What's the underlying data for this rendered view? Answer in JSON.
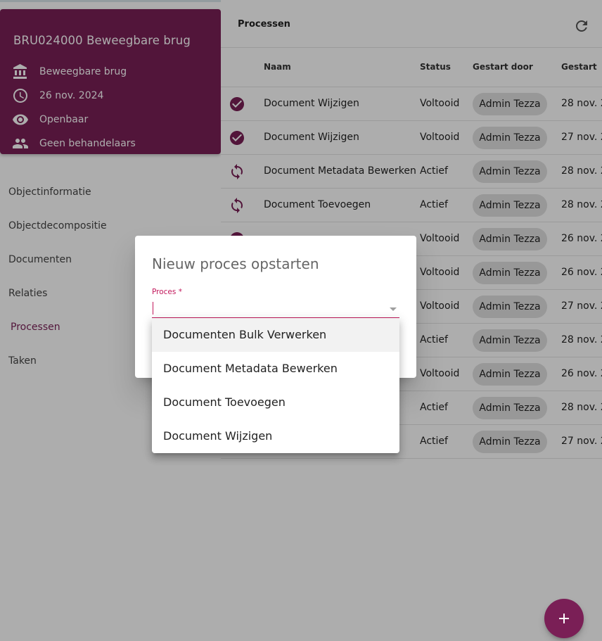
{
  "object": {
    "title": "BRU024000 Beweegbare brug",
    "type": "Beweegbare brug",
    "date": "26 nov. 2024",
    "visibility": "Openbaar",
    "handlers": "Geen behandelaars"
  },
  "nav": {
    "items": [
      {
        "label": "Objectinformatie"
      },
      {
        "label": "Objectdecompositie"
      },
      {
        "label": "Documenten"
      },
      {
        "label": "Relaties"
      },
      {
        "label": "Processen",
        "active": true
      },
      {
        "label": "Taken"
      }
    ]
  },
  "panel": {
    "title": "Processen",
    "columns": {
      "naam": "Naam",
      "status": "Status",
      "gestart_door": "Gestart door",
      "gestart": "Gestart"
    },
    "rows": [
      {
        "icon": "check-circle-icon",
        "naam": "Document Wijzigen",
        "status": "Voltooid",
        "by": "Admin Tezza",
        "date": "28 nov. 2"
      },
      {
        "icon": "check-circle-icon",
        "naam": "Document Wijzigen",
        "status": "Voltooid",
        "by": "Admin Tezza",
        "date": "27 nov. 2"
      },
      {
        "icon": "sync-icon",
        "naam": "Document Metadata Bewerken",
        "status": "Actief",
        "by": "Admin Tezza",
        "date": "28 nov. 2"
      },
      {
        "icon": "sync-icon",
        "naam": "Document Toevoegen",
        "status": "Actief",
        "by": "Admin Tezza",
        "date": "28 nov. 2"
      },
      {
        "icon": "check-circle-icon",
        "naam": "",
        "status": "Voltooid",
        "by": "Admin Tezza",
        "date": "26 nov. 2"
      },
      {
        "icon": "check-circle-icon",
        "naam": "",
        "status": "Voltooid",
        "by": "Admin Tezza",
        "date": "26 nov. 2"
      },
      {
        "icon": "check-circle-icon",
        "naam": "",
        "status": "Voltooid",
        "by": "Admin Tezza",
        "date": "27 nov. 2"
      },
      {
        "icon": "sync-icon",
        "naam": "",
        "status": "Actief",
        "by": "Admin Tezza",
        "date": "28 nov. 2"
      },
      {
        "icon": "check-circle-icon",
        "naam": "",
        "status": "Voltooid",
        "by": "Admin Tezza",
        "date": "26 nov. 2"
      },
      {
        "icon": "sync-icon",
        "naam": "",
        "status": "Actief",
        "by": "Admin Tezza",
        "date": "28 nov. 2"
      },
      {
        "icon": "sync-icon",
        "naam": "",
        "status": "Actief",
        "by": "Admin Tezza",
        "date": "27 nov. 2"
      }
    ]
  },
  "dialog": {
    "title": "Nieuw proces opstarten",
    "field_label": "Proces *",
    "options": [
      "Documenten Bulk Verwerken",
      "Document Metadata Bewerken",
      "Document Toevoegen",
      "Document Wijzigen"
    ]
  },
  "colors": {
    "brand": "#7a1f56",
    "accent": "#c2185b"
  }
}
